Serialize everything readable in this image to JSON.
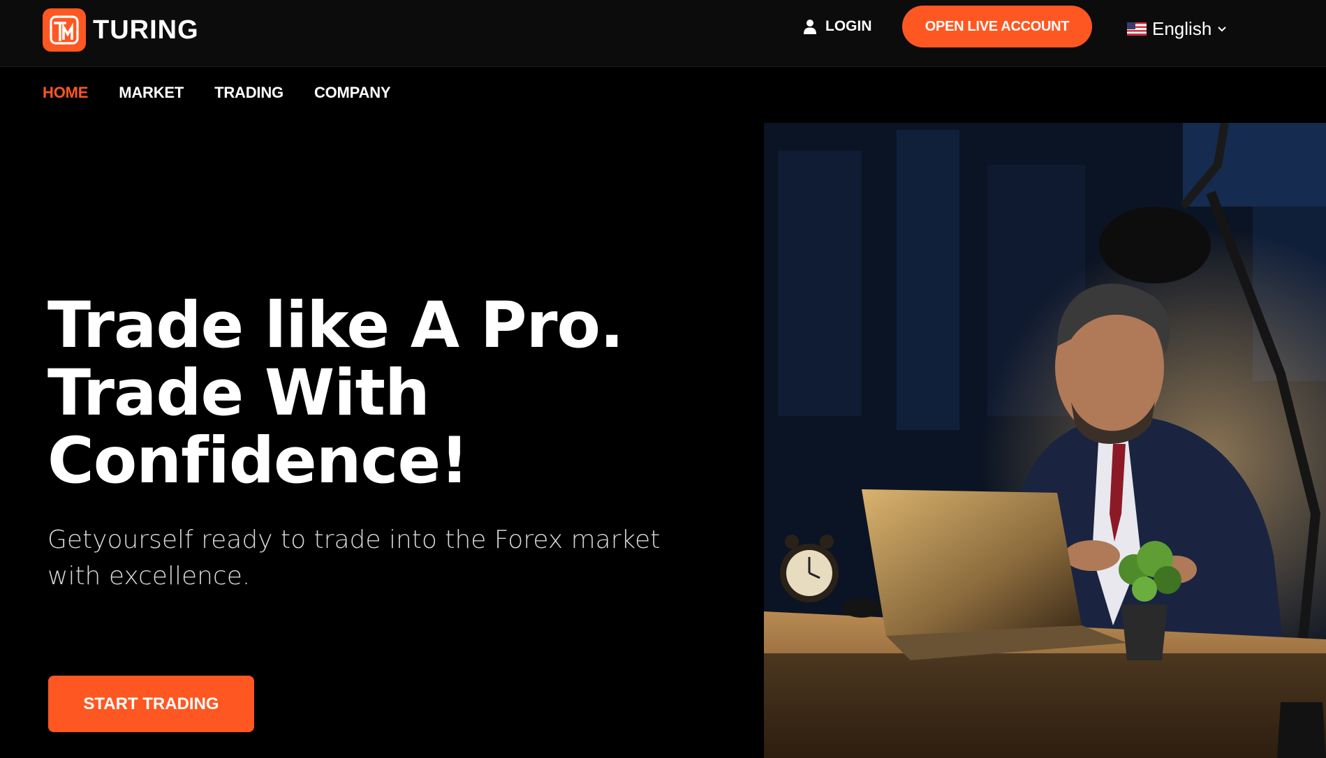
{
  "header": {
    "brand_name": "TURING",
    "logo_letters": "TM",
    "login_label": "LOGIN",
    "open_account_label": "OPEN LIVE ACCOUNT",
    "language_label": "English"
  },
  "nav": {
    "items": [
      {
        "label": "HOME",
        "active": true
      },
      {
        "label": "MARKET",
        "active": false
      },
      {
        "label": "TRADING",
        "active": false
      },
      {
        "label": "COMPANY",
        "active": false
      }
    ]
  },
  "hero": {
    "headline_lines": [
      "Trade like A Pro.",
      "Trade With",
      "Confidence!"
    ],
    "subtitle": "Getyourself ready to trade into the Forex market with excellence.",
    "cta_label": "START TRADING"
  },
  "colors": {
    "accent": "#ff5722",
    "background": "#000000",
    "topbar": "#0c0c0c",
    "text": "#ffffff"
  },
  "icons": [
    "logo-icon",
    "user-icon",
    "us-flag-icon",
    "chevron-down-icon"
  ]
}
